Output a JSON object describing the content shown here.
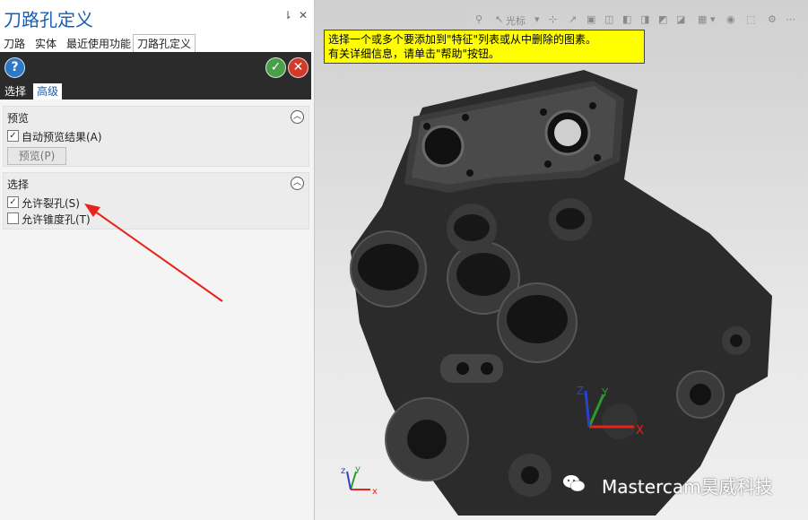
{
  "panel": {
    "title": "刀路孔定义",
    "pin_glyph": "⇂",
    "close_glyph": "✕",
    "tabs": [
      "刀路",
      "实体",
      "最近使用功能",
      "刀路孔定义"
    ],
    "active_tab_index": 3,
    "help_glyph": "?",
    "ok_glyph": "✓",
    "cancel_glyph": "✕",
    "subtabs": [
      "选择",
      "高级"
    ],
    "active_subtab_index": 1,
    "preview_section": {
      "title": "预览",
      "collapse_glyph": "︿",
      "auto_preview_label": "自动预览结果(A)",
      "auto_preview_checked": true,
      "preview_button_label": "预览(P)"
    },
    "select_section": {
      "title": "选择",
      "collapse_glyph": "︿",
      "allow_split_label": "允许裂孔(S)",
      "allow_split_checked": true,
      "allow_tapered_label": "允许锥度孔(T)",
      "allow_tapered_checked": false
    }
  },
  "viewport": {
    "toolbar_label": "光标",
    "tooltip_line1": "选择一个或多个要添加到\"特征\"列表或从中删除的图素。",
    "tooltip_line2": "有关详细信息，请单击\"帮助\"按钮。",
    "watermark": "Mastercam昊威科技",
    "axis": {
      "x": "X",
      "y": "Y",
      "z": "Z"
    },
    "mini_axis": {
      "x": "x",
      "y": "y",
      "z": "z"
    }
  },
  "colors": {
    "accent_blue": "#1a5fb4",
    "tooltip_yellow": "#ffff00",
    "arrow_red": "#e8231a",
    "part_dark": "#2a2a2a"
  }
}
